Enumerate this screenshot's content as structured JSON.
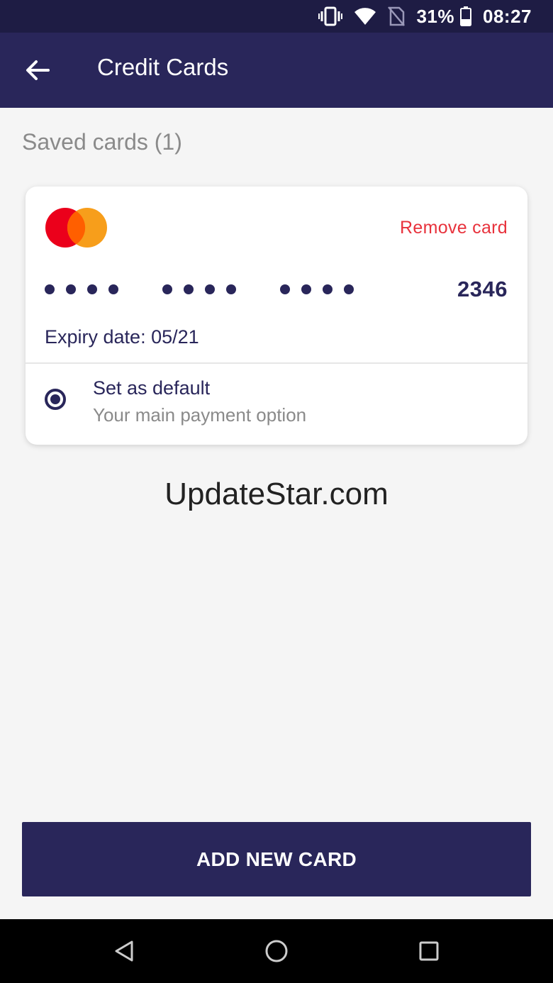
{
  "status_bar": {
    "battery_text": "31%",
    "time": "08:27",
    "icons": [
      "vibrate-icon",
      "wifi-icon",
      "no-sim-icon",
      "battery-icon"
    ]
  },
  "app_bar": {
    "back_icon": "arrow-left-icon",
    "title": "Credit Cards"
  },
  "saved_cards": {
    "heading": "Saved cards (1)",
    "cards": [
      {
        "brand_icon": "mastercard-logo",
        "remove_label": "Remove card",
        "last4": "2346",
        "expiry_label": "Expiry date: 05/21",
        "default_title": "Set as default",
        "default_subtitle": "Your main payment option",
        "is_default": true
      }
    ]
  },
  "watermark": "UpdateStar.com",
  "add_button_label": "ADD NEW CARD",
  "nav_bar": {
    "icons": [
      "nav-back-icon",
      "nav-home-icon",
      "nav-recents-icon"
    ]
  },
  "colors": {
    "primary": "#29265a",
    "status_bar": "#1e1c44",
    "danger": "#e8323c",
    "muted": "#8a8a8a",
    "background": "#f5f5f5"
  }
}
